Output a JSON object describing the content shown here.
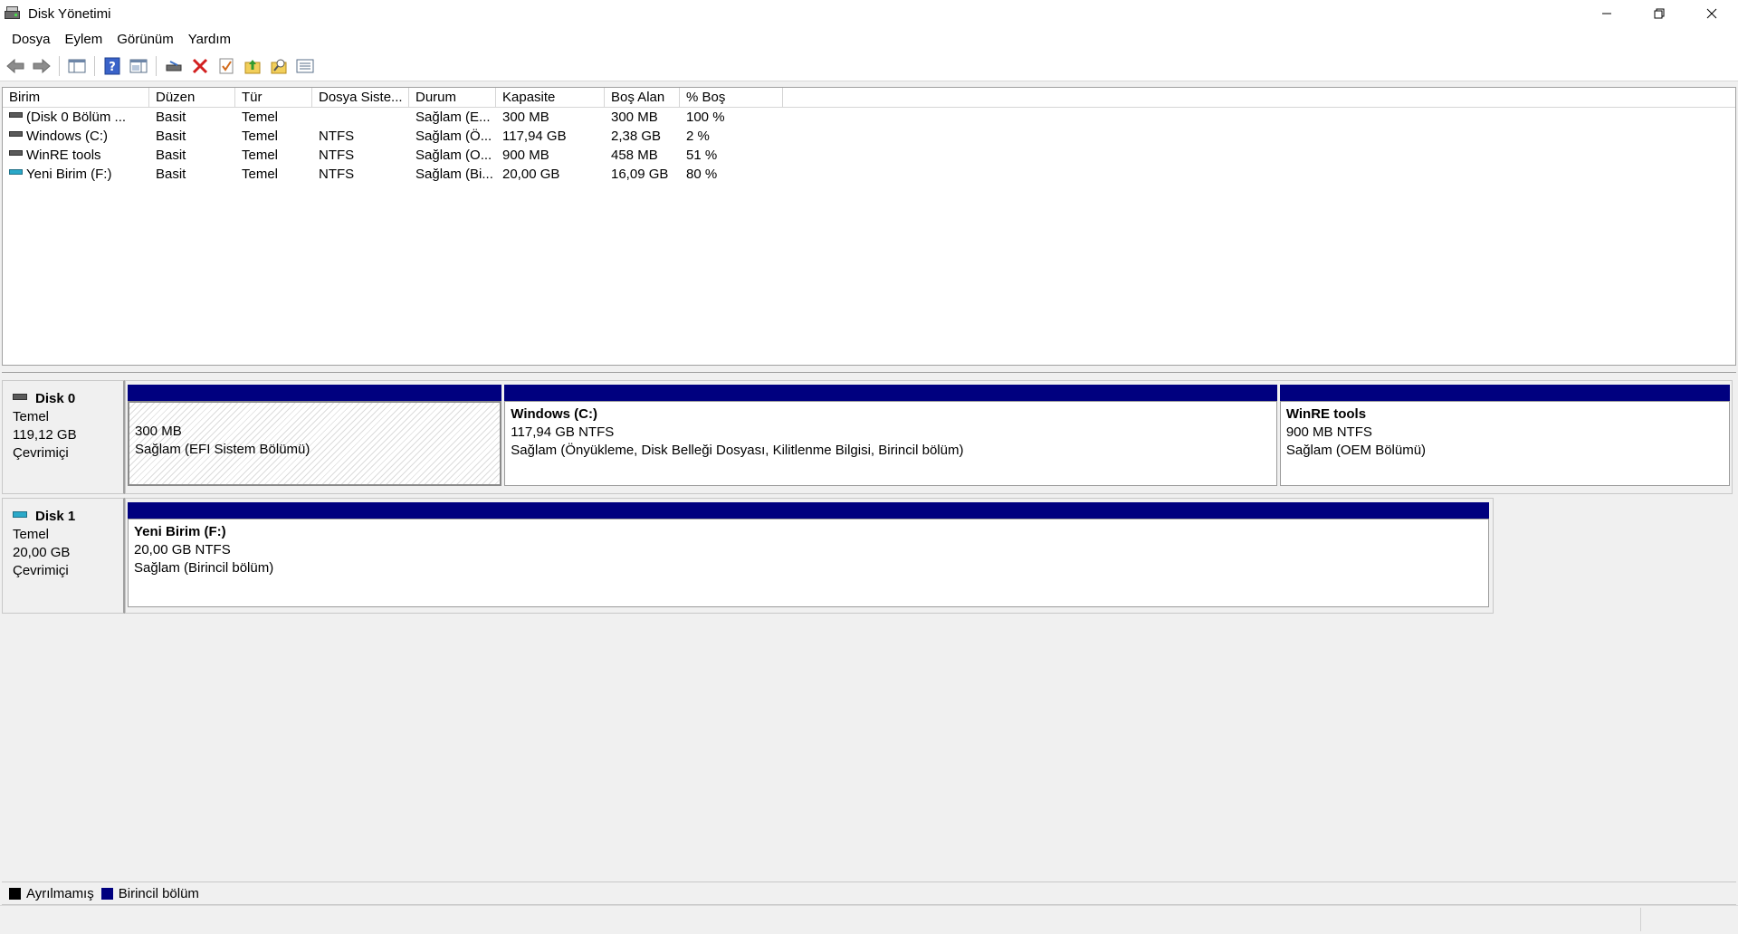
{
  "window": {
    "title": "Disk Yönetimi"
  },
  "menu": [
    "Dosya",
    "Eylem",
    "Görünüm",
    "Yardım"
  ],
  "toolbar": {
    "icons": [
      "back-arrow-icon",
      "forward-arrow-icon",
      "console-tree-icon",
      "help-icon",
      "properties-pane-icon",
      "connect-disk-icon",
      "delete-icon",
      "check-icon",
      "folder-up-icon",
      "folder-search-icon",
      "list-view-icon"
    ]
  },
  "volume_list": {
    "columns": [
      "Birim",
      "Düzen",
      "Tür",
      "Dosya Siste...",
      "Durum",
      "Kapasite",
      "Boş Alan",
      "% Boş"
    ],
    "rows": [
      {
        "icon": "gray",
        "cells": [
          "(Disk 0 Bölüm ...",
          "Basit",
          "Temel",
          "",
          "Sağlam (E...",
          "300 MB",
          "300 MB",
          "100 %"
        ]
      },
      {
        "icon": "gray",
        "cells": [
          "Windows (C:)",
          "Basit",
          "Temel",
          "NTFS",
          "Sağlam (Ö...",
          "117,94 GB",
          "2,38 GB",
          "2 %"
        ]
      },
      {
        "icon": "gray",
        "cells": [
          "WinRE tools",
          "Basit",
          "Temel",
          "NTFS",
          "Sağlam (O...",
          "900 MB",
          "458 MB",
          "51 %"
        ]
      },
      {
        "icon": "teal",
        "cells": [
          "Yeni Birim (F:)",
          "Basit",
          "Temel",
          "NTFS",
          "Sağlam (Bi...",
          "20,00 GB",
          "16,09 GB",
          "80 %"
        ]
      }
    ]
  },
  "disks": [
    {
      "name": "Disk 0",
      "type": "Temel",
      "size": "119,12 GB",
      "status": "Çevrimiçi",
      "partitions": [
        {
          "name": "",
          "size": "300 MB",
          "status": "Sağlam (EFI Sistem Bölümü)"
        },
        {
          "name": "Windows  (C:)",
          "size": "117,94 GB NTFS",
          "status": "Sağlam (Önyükleme, Disk Belleği Dosyası, Kilitlenme Bilgisi, Birincil bölüm)"
        },
        {
          "name": "WinRE tools",
          "size": "900 MB NTFS",
          "status": "Sağlam (OEM Bölümü)"
        }
      ]
    },
    {
      "name": "Disk 1",
      "type": "Temel",
      "size": "20,00 GB",
      "status": "Çevrimiçi",
      "partitions": [
        {
          "name": "Yeni Birim  (F:)",
          "size": "20,00 GB NTFS",
          "status": "Sağlam (Birincil bölüm)"
        }
      ]
    }
  ],
  "legend": [
    {
      "label": "Ayrılmamış",
      "color": "#000000"
    },
    {
      "label": "Birincil bölüm",
      "color": "#00007f"
    }
  ],
  "colors": {
    "primary_partition": "#00007f",
    "unallocated": "#000000",
    "removable_disk": "#2aa9c9"
  }
}
